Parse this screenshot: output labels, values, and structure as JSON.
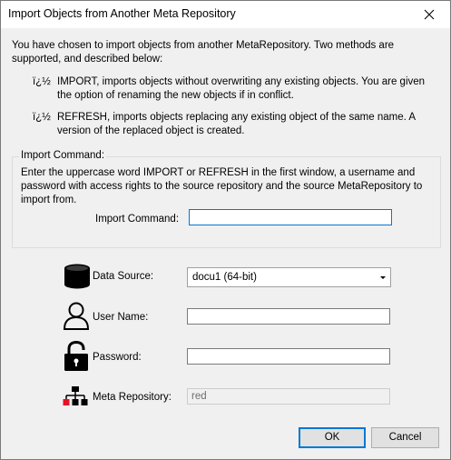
{
  "window": {
    "title": "Import Objects from Another Meta Repository"
  },
  "intro": "You have chosen to import objects from another MetaRepository. Two methods are supported, and described below:",
  "bullets": [
    {
      "mark": "ï¿½",
      "text": "IMPORT, imports objects without overwriting any existing objects. You are given the option of renaming the new objects if in conflict."
    },
    {
      "mark": "ï¿½",
      "text": "REFRESH, imports objects replacing any existing object of the same name. A version of the replaced object is created."
    }
  ],
  "import_group": {
    "label": "Import Command:",
    "description": "Enter the uppercase word IMPORT or REFRESH in the first window, a username and password with access rights to the source repository and the source MetaRepository to import from.",
    "command_label": "Import Command:",
    "command_value": ""
  },
  "fields": {
    "data_source_label": "Data Source:",
    "data_source_value": "docu1 (64-bit)",
    "user_name_label": "User Name:",
    "user_name_value": "",
    "password_label": "Password:",
    "password_value": "",
    "meta_repository_label": "Meta Repository:",
    "meta_repository_value": "red"
  },
  "buttons": {
    "ok": "OK",
    "cancel": "Cancel"
  },
  "icons": {
    "close": "close-icon",
    "data_source": "database-icon",
    "user": "user-icon",
    "password": "unlocked-padlock-icon",
    "meta_repository": "network-hierarchy-icon"
  },
  "colors": {
    "focus_border": "#0078d7",
    "hierarchy_red": "#e81123"
  }
}
